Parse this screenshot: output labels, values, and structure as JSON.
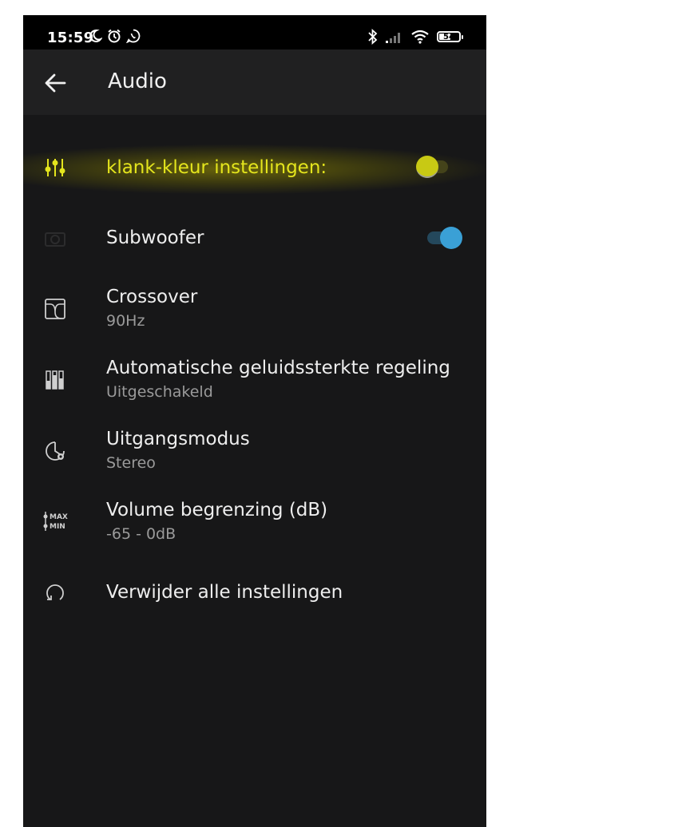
{
  "status_bar": {
    "time": "15:59",
    "battery_level": "54",
    "icons_left": [
      "moon-icon",
      "alarm-icon",
      "whatsapp-icon"
    ],
    "icons_right": [
      "bluetooth-icon",
      "signal-icon",
      "wifi-icon",
      "battery-icon"
    ]
  },
  "app_bar": {
    "title": "Audio",
    "back_icon": "arrow-left-icon"
  },
  "colors": {
    "highlight": "#e4e51d",
    "toggle_on": "#3aa0d6",
    "background": "#171718"
  },
  "settings": [
    {
      "title": "klank-kleur instellingen:",
      "icon": "equalizer-icon",
      "toggle": false,
      "highlighted": true
    },
    {
      "title": "Subwoofer",
      "icon": "subwoofer-icon",
      "toggle": true
    },
    {
      "title": "Crossover",
      "subtitle": "90Hz",
      "icon": "crossover-icon"
    },
    {
      "title": "Automatische geluidssterkte regeling",
      "subtitle": "Uitgeschakeld",
      "icon": "loudness-icon"
    },
    {
      "title": "Uitgangsmodus",
      "subtitle": "Stereo",
      "icon": "output-mode-icon"
    },
    {
      "title": "Volume begrenzing (dB)",
      "subtitle": "-65 - 0dB",
      "icon": "volume-limit-icon",
      "icon_text_top": "MAX",
      "icon_text_bottom": "MIN"
    },
    {
      "title": "Verwijder alle instellingen",
      "icon": "reset-icon"
    }
  ]
}
